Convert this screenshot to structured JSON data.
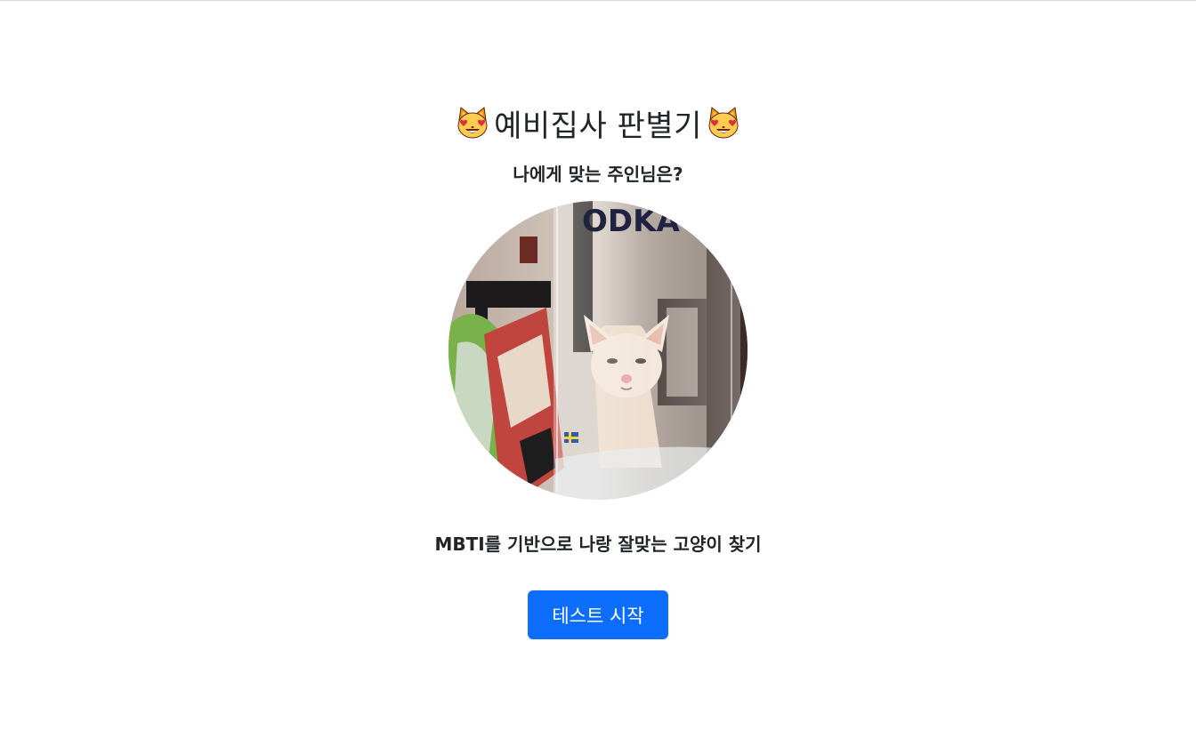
{
  "header": {
    "title": "예비집사 판별기",
    "title_icon": "smiling-cat-heart-eyes-icon",
    "subtitle": "나에게 맞는 주인님은?"
  },
  "main": {
    "image_subject": "cat-behind-glass-photo",
    "description": "MBTI를 기반으로 나랑 잘맞는 고양이 찾기",
    "start_button_label": "테스트 시작"
  },
  "colors": {
    "accent": "#0d6efd",
    "text": "#212529",
    "background": "#ffffff"
  }
}
